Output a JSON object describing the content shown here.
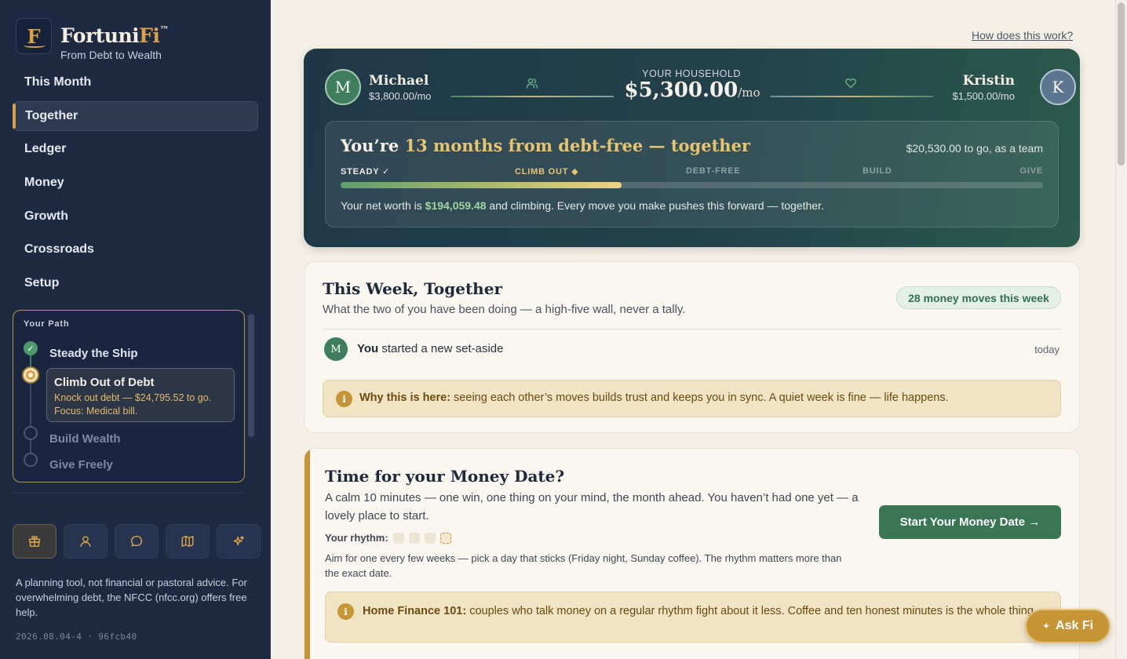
{
  "brand": {
    "logo_letter": "F",
    "name_a": "Fortuni",
    "name_b": "Fi",
    "tm": "™",
    "tagline": "From Debt to Wealth"
  },
  "nav": {
    "items": [
      {
        "label": "This Month"
      },
      {
        "label": "Together",
        "active": true
      },
      {
        "label": "Ledger"
      },
      {
        "label": "Money"
      },
      {
        "label": "Growth"
      },
      {
        "label": "Crossroads"
      },
      {
        "label": "Setup"
      }
    ]
  },
  "path": {
    "title": "Your Path",
    "done_check": "✓",
    "steps": [
      {
        "label": "Steady the Ship",
        "state": "done"
      },
      {
        "label": "Climb Out of Debt",
        "state": "current",
        "desc1": "Knock out debt — $24,795.52 to go.",
        "desc2": "Focus: Medical bill."
      },
      {
        "label": "Build Wealth",
        "state": "todo"
      },
      {
        "label": "Give Freely",
        "state": "todo"
      }
    ]
  },
  "toolbar_icons": [
    "gift-icon",
    "person-icon",
    "chat-icon",
    "map-icon",
    "sparkle-icon"
  ],
  "disclaimer": "A planning tool, not financial or pastoral advice. For overwhelming debt, the NFCC (nfcc.org) offers free help.",
  "version": "2026.08.04-4 · 96fcb40",
  "help_link": "How does this work?",
  "household": {
    "partner1": {
      "initial": "M",
      "name": "Michael",
      "income": "$3,800.00/mo"
    },
    "partner2": {
      "initial": "K",
      "name": "Kristin",
      "income": "$1,500.00/mo"
    },
    "label": "YOUR HOUSEHOLD",
    "amount": "$5,300.00",
    "per": "/mo",
    "headline_a": "You’re ",
    "headline_hl": "13 months from debt-free — together",
    "to_go": "$20,530.00 to go, as a team",
    "stages": [
      "STEADY ✓",
      "CLIMB OUT ◆",
      "DEBT-FREE",
      "BUILD",
      "GIVE"
    ],
    "progress_pct": 40,
    "networth_a": "Your net worth is ",
    "networth_value": "$194,059.48",
    "networth_b": " and climbing. Every move you make pushes this forward — together."
  },
  "week": {
    "title": "This Week, Together",
    "subtitle": "What the two of you have been doing — a high-five wall, never a tally.",
    "badge": "28 money moves this week",
    "activity": {
      "initial": "M",
      "who": "You",
      "what": " started a new set-aside",
      "when": "today"
    },
    "note_icon": "i",
    "note_bold": "Why this is here:",
    "note_text": " seeing each other’s moves builds trust and keeps you in sync. A quiet week is fine — life happens."
  },
  "money_date": {
    "title": "Time for your Money Date?",
    "subtitle": "A calm 10 minutes — one win, one thing on your mind, the month ahead. You haven’t had one yet — a lovely place to start.",
    "rhythm_label": "Your rhythm:",
    "help": "Aim for one every few weeks — pick a day that sticks (Friday night, Sunday coffee). The rhythm matters more than the exact date.",
    "cta": "Start Your Money Date →",
    "note_icon": "i",
    "note_bold": "Home Finance 101:",
    "note_text": " couples who talk money on a regular rhythm fight about it less. Coffee and ten honest minutes is the whole thing."
  },
  "ask": {
    "label": "Ask Fi",
    "icon": "✦"
  },
  "colors": {
    "sidebar": "#1d2a42",
    "accent": "#d8a24a",
    "green": "#3a7554",
    "cream": "#faf7f1"
  }
}
